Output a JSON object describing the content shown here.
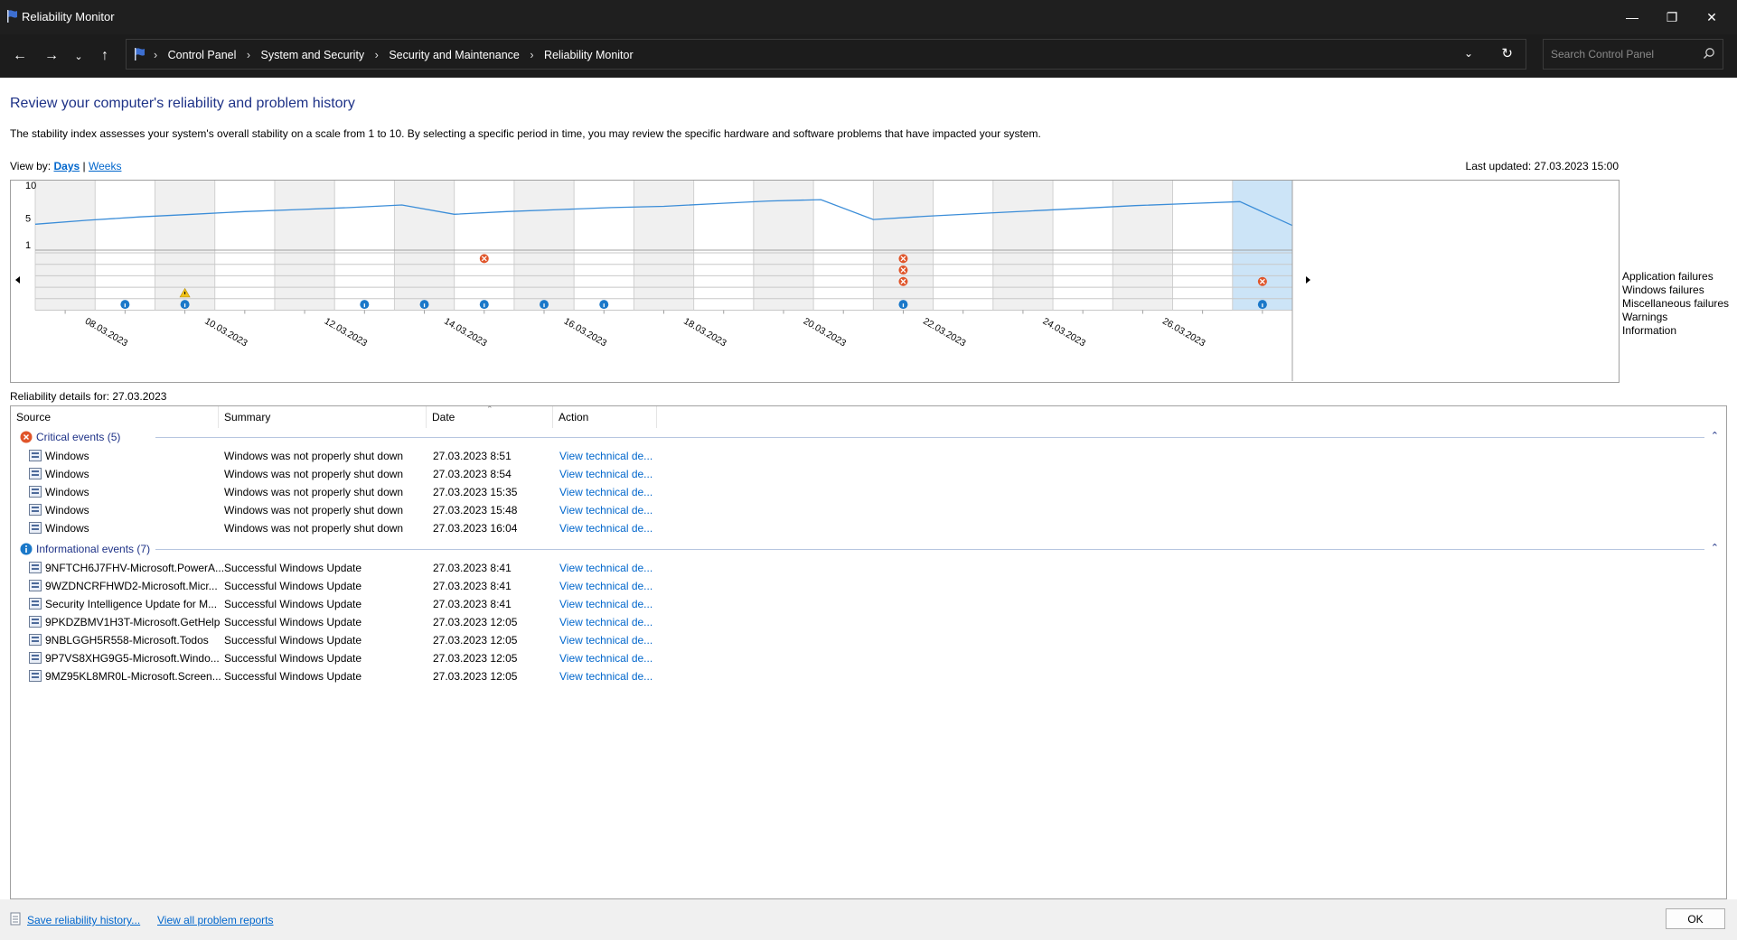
{
  "window": {
    "title": "Reliability Monitor"
  },
  "nav": {
    "crumbs": [
      "Control Panel",
      "System and Security",
      "Security and Maintenance",
      "Reliability Monitor"
    ],
    "search_placeholder": "Search Control Panel"
  },
  "page": {
    "title": "Review your computer's reliability and problem history",
    "description": "The stability index assesses your system's overall stability on a scale from 1 to 10. By selecting a specific period in time, you may review the specific hardware and software problems that have impacted your system.",
    "view_by_label": "View by:",
    "view_days": "Days",
    "view_sep": "|",
    "view_weeks": "Weeks",
    "last_updated": "Last updated: 27.03.2023 15:00"
  },
  "chart_data": {
    "type": "line",
    "y_ticks": [
      "10",
      "5",
      "1"
    ],
    "ylim": [
      1,
      10
    ],
    "x": [
      "07.03",
      "08.03",
      "09.03",
      "10.03",
      "11.03",
      "12.03",
      "13.03",
      "14.03",
      "15.03",
      "16.03",
      "17.03",
      "18.03",
      "19.03",
      "20.03",
      "21.03",
      "22.03",
      "23.03",
      "24.03",
      "25.03",
      "26.03",
      "27.03"
    ],
    "x_tick_labels": [
      "08.03.2023",
      "10.03.2023",
      "12.03.2023",
      "14.03.2023",
      "16.03.2023",
      "18.03.2023",
      "20.03.2023",
      "22.03.2023",
      "24.03.2023",
      "26.03.2023"
    ],
    "stability_index": [
      4.1,
      4.7,
      5.2,
      5.6,
      6.0,
      6.3,
      6.6,
      7.0,
      5.6,
      6.0,
      6.3,
      6.6,
      6.8,
      7.2,
      7.6,
      7.8,
      4.8,
      5.3,
      5.7,
      6.1,
      6.5,
      6.9,
      7.2,
      7.5,
      3.9
    ],
    "rows": [
      "Application failures",
      "Windows failures",
      "Miscellaneous failures",
      "Warnings",
      "Information"
    ],
    "events": {
      "Application failures": [
        "14.03.2023",
        "21.03.2023"
      ],
      "Windows failures": [
        "21.03.2023"
      ],
      "Miscellaneous failures": [
        "21.03.2023",
        "27.03.2023"
      ],
      "Warnings": [
        "09.03.2023"
      ],
      "Information": [
        "08.03.2023",
        "09.03.2023",
        "12.03.2023",
        "13.03.2023",
        "14.03.2023",
        "15.03.2023",
        "16.03.2023",
        "21.03.2023",
        "27.03.2023"
      ]
    },
    "selected": "27.03.2023",
    "colors": {
      "line": "#3b8dd8",
      "error": "#e0552a",
      "warning": "#f2c318",
      "info": "#1a78c9",
      "selected": "#cce4f7"
    }
  },
  "details": {
    "label": "Reliability details for: 27.03.2023",
    "columns": [
      "Source",
      "Summary",
      "Date",
      "Action"
    ],
    "critical_title": "Critical events (5)",
    "critical": [
      {
        "source": "Windows",
        "summary": "Windows was not properly shut down",
        "date": "27.03.2023 8:51",
        "action": "View technical de..."
      },
      {
        "source": "Windows",
        "summary": "Windows was not properly shut down",
        "date": "27.03.2023 8:54",
        "action": "View technical de..."
      },
      {
        "source": "Windows",
        "summary": "Windows was not properly shut down",
        "date": "27.03.2023 15:35",
        "action": "View technical de..."
      },
      {
        "source": "Windows",
        "summary": "Windows was not properly shut down",
        "date": "27.03.2023 15:48",
        "action": "View technical de..."
      },
      {
        "source": "Windows",
        "summary": "Windows was not properly shut down",
        "date": "27.03.2023 16:04",
        "action": "View technical de..."
      }
    ],
    "info_title": "Informational events (7)",
    "info": [
      {
        "source": "9NFTCH6J7FHV-Microsoft.PowerA...",
        "summary": "Successful Windows Update",
        "date": "27.03.2023 8:41",
        "action": "View technical de..."
      },
      {
        "source": "9WZDNCRFHWD2-Microsoft.Micr...",
        "summary": "Successful Windows Update",
        "date": "27.03.2023 8:41",
        "action": "View technical de..."
      },
      {
        "source": "Security Intelligence Update for M...",
        "summary": "Successful Windows Update",
        "date": "27.03.2023 8:41",
        "action": "View technical de..."
      },
      {
        "source": "9PKDZBMV1H3T-Microsoft.GetHelp",
        "summary": "Successful Windows Update",
        "date": "27.03.2023 12:05",
        "action": "View technical de..."
      },
      {
        "source": "9NBLGGH5R558-Microsoft.Todos",
        "summary": "Successful Windows Update",
        "date": "27.03.2023 12:05",
        "action": "View technical de..."
      },
      {
        "source": "9P7VS8XHG9G5-Microsoft.Windo...",
        "summary": "Successful Windows Update",
        "date": "27.03.2023 12:05",
        "action": "View technical de..."
      },
      {
        "source": "9MZ95KL8MR0L-Microsoft.Screen...",
        "summary": "Successful Windows Update",
        "date": "27.03.2023 12:05",
        "action": "View technical de..."
      }
    ]
  },
  "footer": {
    "save_link": "Save reliability history...",
    "problems_link": "View all problem reports",
    "ok": "OK"
  }
}
